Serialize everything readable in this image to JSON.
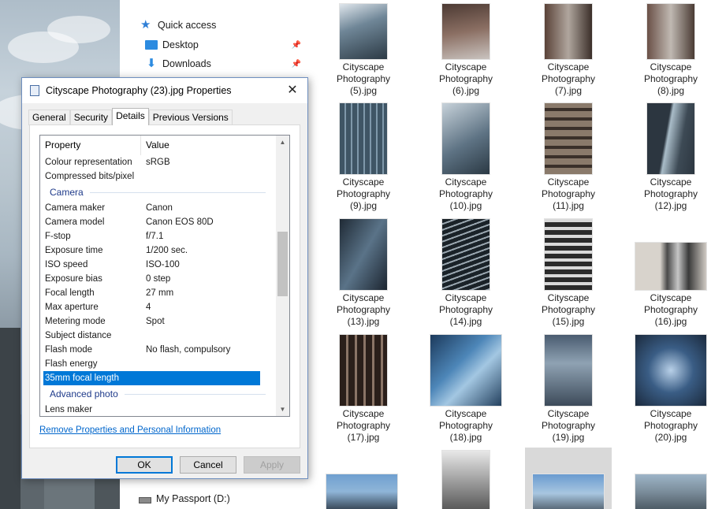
{
  "nav": {
    "quick_access": "Quick access",
    "desktop": "Desktop",
    "downloads": "Downloads",
    "drive": "My Passport (D:)"
  },
  "files": [
    {
      "caption": [
        "Cityscape",
        "Photography",
        "(5).jpg"
      ]
    },
    {
      "caption": [
        "Cityscape",
        "Photography",
        "(6).jpg"
      ]
    },
    {
      "caption": [
        "Cityscape",
        "Photography",
        "(7).jpg"
      ]
    },
    {
      "caption": [
        "Cityscape",
        "Photography",
        "(8).jpg"
      ]
    },
    {
      "caption": [
        "Cityscape",
        "Photography",
        "(9).jpg"
      ]
    },
    {
      "caption": [
        "Cityscape",
        "Photography",
        "(10).jpg"
      ]
    },
    {
      "caption": [
        "Cityscape",
        "Photography",
        "(11).jpg"
      ]
    },
    {
      "caption": [
        "Cityscape",
        "Photography",
        "(12).jpg"
      ]
    },
    {
      "caption": [
        "Cityscape",
        "Photography",
        "(13).jpg"
      ]
    },
    {
      "caption": [
        "Cityscape",
        "Photography",
        "(14).jpg"
      ]
    },
    {
      "caption": [
        "Cityscape",
        "Photography",
        "(15).jpg"
      ]
    },
    {
      "caption": [
        "Cityscape",
        "Photography",
        "(16).jpg"
      ]
    },
    {
      "caption": [
        "Cityscape",
        "Photography",
        "(17).jpg"
      ]
    },
    {
      "caption": [
        "Cityscape",
        "Photography",
        "(18).jpg"
      ]
    },
    {
      "caption": [
        "Cityscape",
        "Photography",
        "(19).jpg"
      ]
    },
    {
      "caption": [
        "Cityscape",
        "Photography",
        "(20).jpg"
      ]
    }
  ],
  "dialog": {
    "title": "Cityscape Photography (23).jpg Properties",
    "tabs": [
      "General",
      "Security",
      "Details",
      "Previous Versions"
    ],
    "active_tab": "Details",
    "header": {
      "property": "Property",
      "value": "Value"
    },
    "rows_top": [
      {
        "k": "Colour representation",
        "v": "sRGB"
      },
      {
        "k": "Compressed bits/pixel",
        "v": ""
      }
    ],
    "group_camera": "Camera",
    "rows_camera": [
      {
        "k": "Camera maker",
        "v": "Canon"
      },
      {
        "k": "Camera model",
        "v": "Canon EOS 80D"
      },
      {
        "k": "F-stop",
        "v": "f/7.1"
      },
      {
        "k": "Exposure time",
        "v": "1/200 sec."
      },
      {
        "k": "ISO speed",
        "v": "ISO-100"
      },
      {
        "k": "Exposure bias",
        "v": "0 step"
      },
      {
        "k": "Focal length",
        "v": "27 mm"
      },
      {
        "k": "Max aperture",
        "v": "4"
      },
      {
        "k": "Metering mode",
        "v": "Spot"
      },
      {
        "k": "Subject distance",
        "v": ""
      },
      {
        "k": "Flash mode",
        "v": "No flash, compulsory"
      },
      {
        "k": "Flash energy",
        "v": ""
      }
    ],
    "selected_row": {
      "k": "35mm focal length",
      "v": ""
    },
    "group_advanced": "Advanced photo",
    "rows_advanced": [
      {
        "k": "Lens maker",
        "v": ""
      }
    ],
    "remove_link": "Remove Properties and Personal Information",
    "buttons": {
      "ok": "OK",
      "cancel": "Cancel",
      "apply": "Apply"
    }
  },
  "colors": {
    "selection": "#0078d7",
    "link": "#0066cc",
    "group_header": "#1e3a8a"
  }
}
